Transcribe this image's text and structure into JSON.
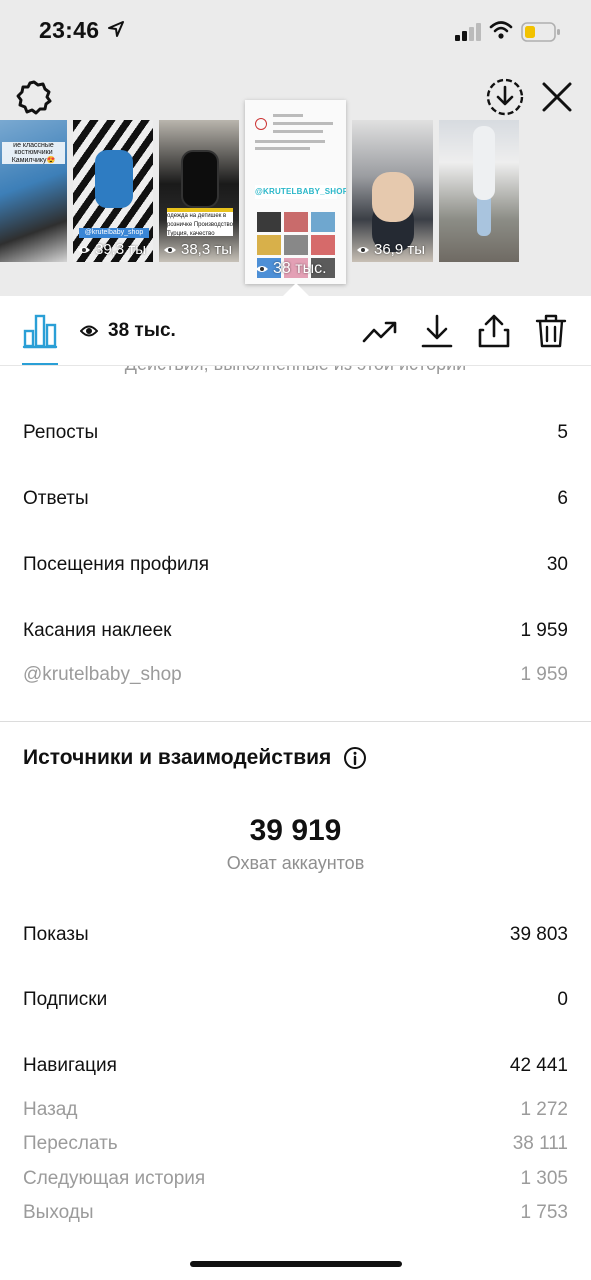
{
  "status_bar": {
    "time": "23:46"
  },
  "stories": [
    {
      "views": "39,3 ты"
    },
    {
      "views": "38,3 ты"
    },
    {
      "views": "38 тыс."
    },
    {
      "views": "36,9 ты"
    }
  ],
  "thumb_texts": {
    "first_caption": "ие классные костюмчики Камилчику😍",
    "tag_handle": "@krutelbaby_shop",
    "tag_note": "одежда на детишек в розничке Производство Турция, качество отличное👌",
    "brand": "@KRUTELBABY_SHOP"
  },
  "toolbar": {
    "views": "38 тыс."
  },
  "interactions": {
    "cut_heading": "Действия, выполненные из этой истории",
    "rows": [
      {
        "label": "Репосты",
        "value": "5"
      },
      {
        "label": "Ответы",
        "value": "6"
      },
      {
        "label": "Посещения профиля",
        "value": "30"
      },
      {
        "label": "Касания наклеек",
        "value": "1 959"
      }
    ],
    "sub_row": {
      "label": "@krutelbaby_shop",
      "value": "1 959"
    }
  },
  "discovery": {
    "title": "Источники и взаимодействия",
    "reach_value": "39 919",
    "reach_label": "Охват аккаунтов",
    "rows": [
      {
        "label": "Показы",
        "value": "39 803"
      },
      {
        "label": "Подписки",
        "value": "0"
      },
      {
        "label": "Навигация",
        "value": "42 441"
      }
    ],
    "navigation_sub": [
      {
        "label": "Назад",
        "value": "1 272"
      },
      {
        "label": "Переслать",
        "value": "38 111"
      },
      {
        "label": "Следующая история",
        "value": "1 305"
      },
      {
        "label": "Выходы",
        "value": "1 753"
      }
    ]
  },
  "colors": {
    "accent": "#2a9fd6",
    "secondary_text": "#9b9b9b",
    "background_top": "#ebebeb"
  },
  "icons": [
    "location-arrow-icon",
    "signal-icon",
    "wifi-icon",
    "battery-icon",
    "settings-icon",
    "download-circle-icon",
    "close-icon",
    "eye-icon",
    "bar-chart-icon",
    "trending-up-icon",
    "download-icon",
    "share-icon",
    "trash-icon",
    "info-icon"
  ]
}
